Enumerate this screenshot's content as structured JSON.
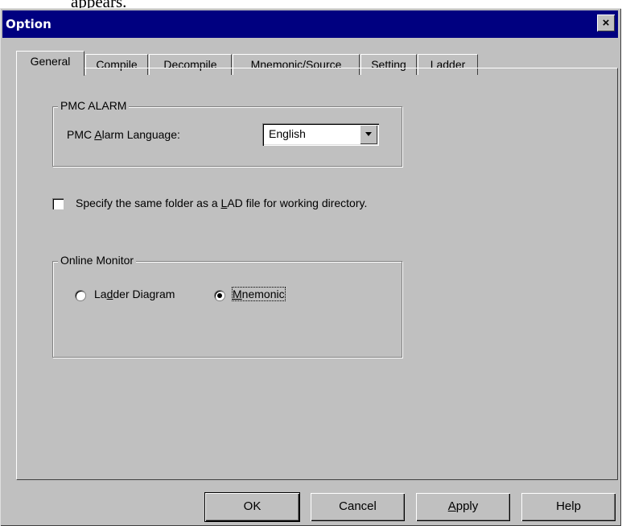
{
  "background_text": "appears.",
  "window": {
    "title": "Option",
    "close_symbol": "×"
  },
  "tabs": [
    {
      "label": "General",
      "active": true
    },
    {
      "label": "Compile",
      "active": false
    },
    {
      "label": "Decompile",
      "active": false
    },
    {
      "label": "Mnemonic/Source",
      "active": false
    },
    {
      "label": "Setting",
      "active": false
    },
    {
      "label": "Ladder",
      "active": false
    }
  ],
  "pmc_alarm": {
    "group_label": "PMC ALARM",
    "language_label_pre": "PMC ",
    "language_label_accel": "A",
    "language_label_post": "larm Language:",
    "language_value": "English"
  },
  "same_folder": {
    "label_pre": "Specify the same folder as a ",
    "label_accel": "L",
    "label_post": "AD file for working directory.",
    "checked": false
  },
  "online_monitor": {
    "group_label": "Online Monitor",
    "ladder_pre": "La",
    "ladder_accel": "d",
    "ladder_post": "der Diagram",
    "ladder_selected": false,
    "mnemonic_accel": "M",
    "mnemonic_post": "nemonic",
    "mnemonic_selected": true
  },
  "buttons": {
    "ok": "OK",
    "cancel": "Cancel",
    "apply_accel": "A",
    "apply_post": "pply",
    "help": "Help"
  }
}
